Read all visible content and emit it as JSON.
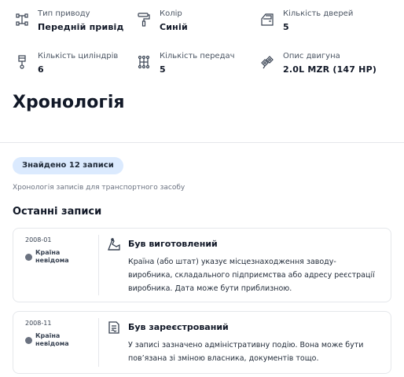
{
  "specs": [
    {
      "label": "Тип приводу",
      "value": "Передній привід",
      "icon": "drivetrain-icon"
    },
    {
      "label": "Колір",
      "value": "Синій",
      "icon": "paint-roller-icon"
    },
    {
      "label": "Кількість дверей",
      "value": "5",
      "icon": "car-door-icon"
    },
    {
      "label": "Кількість циліндрів",
      "value": "6",
      "icon": "cylinder-icon"
    },
    {
      "label": "Кількість передач",
      "value": "5",
      "icon": "gearshift-icon"
    },
    {
      "label": "Опис двигуна",
      "value": "2.0L MZR (147 HP)",
      "icon": "engine-icon"
    }
  ],
  "history": {
    "title": "Хронологія",
    "found_badge": "Знайдено 12 записи",
    "subtitle": "Хронологія записів для транспортного засобу",
    "recent_title": "Останні записи",
    "records": [
      {
        "date": "2008-01",
        "location": "Країна невідома",
        "icon": "factory-icon",
        "title": "Був виготовлений",
        "description": "Країна (або штат) указує місцезнаходження заводу-виробника, складального підприємства або адресу реєстрації виробника. Дата може бути приблизною."
      },
      {
        "date": "2008-11",
        "location": "Країна невідома",
        "icon": "registration-document-icon",
        "title": "Був зареєстрований",
        "description": "У записі зазначено адміністративну подію. Вона може бути пов’язана зі зміною власника, документів тощо."
      }
    ]
  }
}
